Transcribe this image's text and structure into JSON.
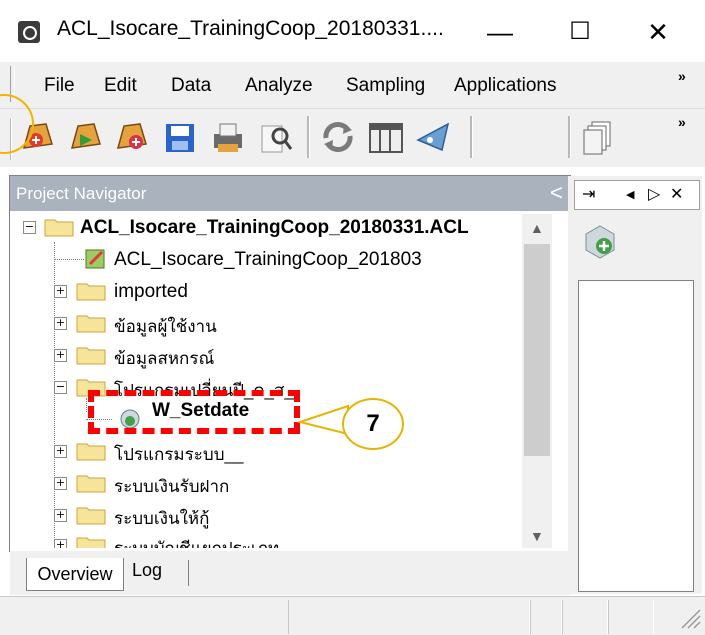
{
  "window": {
    "title": "ACL_Isocare_TrainingCoop_20180331....",
    "minimize": "—",
    "maximize": "☐",
    "close": "✕"
  },
  "menu": {
    "items": [
      "File",
      "Edit",
      "Data",
      "Analyze",
      "Sampling",
      "Applications"
    ],
    "overflow": "»"
  },
  "toolbar": {
    "icons": [
      "open-project-icon",
      "open-table-icon",
      "new-table-icon",
      "save-icon",
      "print-icon",
      "search-icon",
      "refresh-icon",
      "table-layout-icon",
      "filter-icon",
      "copy-icon"
    ],
    "overflow": "»"
  },
  "navigator": {
    "title": "Project Navigator",
    "collapse": "<",
    "items": [
      {
        "label": "ACL_Isocare_TrainingCoop_20180331.ACL",
        "expander": "−"
      },
      {
        "label": "ACL_Isocare_TrainingCoop_201803"
      },
      {
        "label": "imported",
        "expander": "+"
      },
      {
        "label": "ข้อมูลผู้ใช้งาน",
        "expander": "+"
      },
      {
        "label": "ข้อมูลสหกรณ์",
        "expander": "+"
      },
      {
        "label": "โปรแกรมเปลี่ยนปี_ด_ส_",
        "expander": "−"
      },
      {
        "label": "W_Setdate"
      },
      {
        "label": "โปรแกรมระบบ__",
        "expander": "+"
      },
      {
        "label": "ระบบเงินรับฝาก",
        "expander": "+"
      },
      {
        "label": "ระบบเงินให้กู้",
        "expander": "+"
      },
      {
        "label": "ระบบบัญชีแยกประเภท",
        "expander": "+"
      }
    ]
  },
  "tabs": {
    "overview": "Overview",
    "log": "Log"
  },
  "right_panel": {
    "pin": "⇥",
    "prev": "◀",
    "next": "▷",
    "close": "✕"
  },
  "callout": {
    "number": "7",
    "accent": "#ff0000"
  }
}
